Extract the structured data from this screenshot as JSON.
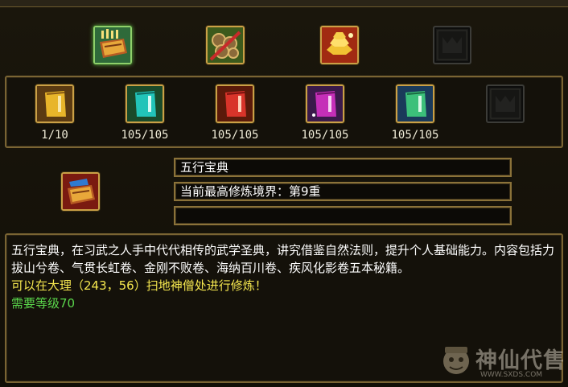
{
  "top_row": [
    {
      "icon": "book-with-candles-icon",
      "selected": true
    },
    {
      "icon": "drum-rolls-icon",
      "selected": false
    },
    {
      "icon": "gold-ingots-icon",
      "selected": false
    },
    {
      "icon": "empty-slot-icon",
      "selected": false
    }
  ],
  "scrolls": [
    {
      "icon": "yellow-scroll-icon",
      "count": "1/10",
      "color": "#e8b52a"
    },
    {
      "icon": "cyan-scroll-icon",
      "count": "105/105",
      "color": "#22c4b9"
    },
    {
      "icon": "red-scroll-icon",
      "count": "105/105",
      "color": "#d8342a"
    },
    {
      "icon": "purple-scroll-icon",
      "count": "105/105",
      "color": "#c52fb8"
    },
    {
      "icon": "green-scroll-icon",
      "count": "105/105",
      "color": "#3cc07a"
    },
    {
      "icon": "empty-slot-icon",
      "count": "",
      "color": "#1a1a18"
    }
  ],
  "detail": {
    "icon": "book-with-candles-icon",
    "name": "五行宝典",
    "realm": "当前最高修炼境界：第9重",
    "extra": ""
  },
  "description": {
    "body": "五行宝典，在习武之人手中代代相传的武学圣典，讲究借鉴自然法则，提升个人基础能力。内容包括力拔山兮卷、气贯长虹卷、金刚不败卷、海纳百川卷、疾风化影卷五本秘籍。",
    "location": "可以在大理（243，56）扫地神僧处进行修炼！",
    "level": "需要等级70"
  },
  "watermark": {
    "text": "神仙代售",
    "url": "WWW.SXDS.COM"
  },
  "colors": {
    "frame_gold": "#7a6433",
    "location_yellow": "#f5e74f",
    "level_green": "#5ad64b"
  }
}
